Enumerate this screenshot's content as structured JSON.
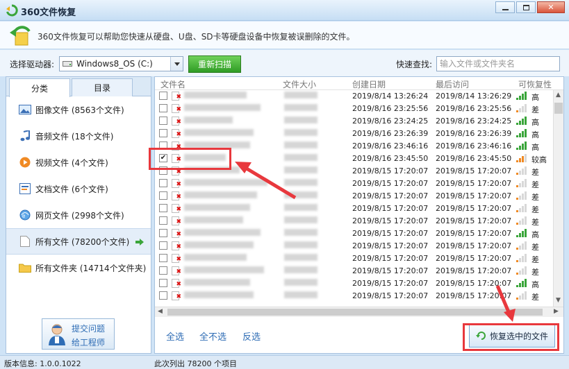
{
  "window": {
    "title": "360文件恢复"
  },
  "infobar": {
    "description": "360文件恢复可以帮助您快速从硬盘、U盘、SD卡等硬盘设备中恢复被误删除的文件。"
  },
  "toolbar": {
    "drive_label": "选择驱动器:",
    "drive_value": "Windows8_OS (C:)",
    "rescan_label": "重新扫描",
    "search_label": "快速查找:",
    "search_placeholder": "输入文件或文件夹名"
  },
  "left": {
    "tabs": [
      "分类",
      "目录"
    ],
    "categories": [
      {
        "label": "图像文件 (8563个文件)",
        "icon": "image-file-icon"
      },
      {
        "label": "音频文件 (18个文件)",
        "icon": "audio-file-icon"
      },
      {
        "label": "视频文件 (4个文件)",
        "icon": "video-file-icon"
      },
      {
        "label": "文档文件 (6个文件)",
        "icon": "document-file-icon"
      },
      {
        "label": "网页文件 (2998个文件)",
        "icon": "web-file-icon"
      },
      {
        "label": "所有文件 (78200个文件)",
        "icon": "all-files-icon"
      },
      {
        "label": "所有文件夹 (14714个文件夹)",
        "icon": "folder-icon"
      }
    ],
    "help": {
      "line1": "提交问题",
      "line2": "给工程师"
    }
  },
  "columns": [
    "文件名",
    "文件大小",
    "创建日期",
    "最后访问",
    "可恢复性"
  ],
  "rows": [
    {
      "created": "2019/8/14 13:26:24",
      "accessed": "2019/8/14 13:26:29",
      "level": "高",
      "bars": 4,
      "checked": false
    },
    {
      "created": "2019/8/16 23:25:56",
      "accessed": "2019/8/16 23:25:56",
      "level": "差",
      "bars": 1,
      "checked": false
    },
    {
      "created": "2019/8/16 23:24:25",
      "accessed": "2019/8/16 23:24:25",
      "level": "高",
      "bars": 4,
      "checked": false
    },
    {
      "created": "2019/8/16 23:26:39",
      "accessed": "2019/8/16 23:26:39",
      "level": "高",
      "bars": 4,
      "checked": false
    },
    {
      "created": "2019/8/16 23:46:16",
      "accessed": "2019/8/16 23:46:16",
      "level": "高",
      "bars": 4,
      "checked": false
    },
    {
      "created": "2019/8/16 23:45:50",
      "accessed": "2019/8/16 23:45:50",
      "level": "较高",
      "bars": 3,
      "checked": true
    },
    {
      "created": "2019/8/15 17:20:07",
      "accessed": "2019/8/15 17:20:07",
      "level": "差",
      "bars": 1,
      "checked": false
    },
    {
      "created": "2019/8/15 17:20:07",
      "accessed": "2019/8/15 17:20:07",
      "level": "差",
      "bars": 1,
      "checked": false
    },
    {
      "created": "2019/8/15 17:20:07",
      "accessed": "2019/8/15 17:20:07",
      "level": "差",
      "bars": 1,
      "checked": false
    },
    {
      "created": "2019/8/15 17:20:07",
      "accessed": "2019/8/15 17:20:07",
      "level": "差",
      "bars": 1,
      "checked": false
    },
    {
      "created": "2019/8/15 17:20:07",
      "accessed": "2019/8/15 17:20:07",
      "level": "差",
      "bars": 1,
      "checked": false
    },
    {
      "created": "2019/8/15 17:20:07",
      "accessed": "2019/8/15 17:20:07",
      "level": "高",
      "bars": 4,
      "checked": false
    },
    {
      "created": "2019/8/15 17:20:07",
      "accessed": "2019/8/15 17:20:07",
      "level": "差",
      "bars": 1,
      "checked": false
    },
    {
      "created": "2019/8/15 17:20:07",
      "accessed": "2019/8/15 17:20:07",
      "level": "差",
      "bars": 1,
      "checked": false
    },
    {
      "created": "2019/8/15 17:20:07",
      "accessed": "2019/8/15 17:20:07",
      "level": "差",
      "bars": 1,
      "checked": false
    },
    {
      "created": "2019/8/15 17:20:07",
      "accessed": "2019/8/15 17:20:07",
      "level": "高",
      "bars": 4,
      "checked": false
    },
    {
      "created": "2019/8/15 17:20:07",
      "accessed": "2019/8/15 17:20:07",
      "level": "差",
      "bars": 1,
      "checked": false
    }
  ],
  "actions": {
    "select_all": "全选",
    "select_none": "全不选",
    "invert": "反选",
    "recover": "恢复选中的文件"
  },
  "status": {
    "version": "版本信息: 1.0.0.1022",
    "count": "此次列出 78200 个项目"
  },
  "colors": {
    "accent_red": "#e8383d",
    "green_bar": "#3aa53a",
    "orange_bar": "#f08a24",
    "link_blue": "#2f6db5"
  }
}
